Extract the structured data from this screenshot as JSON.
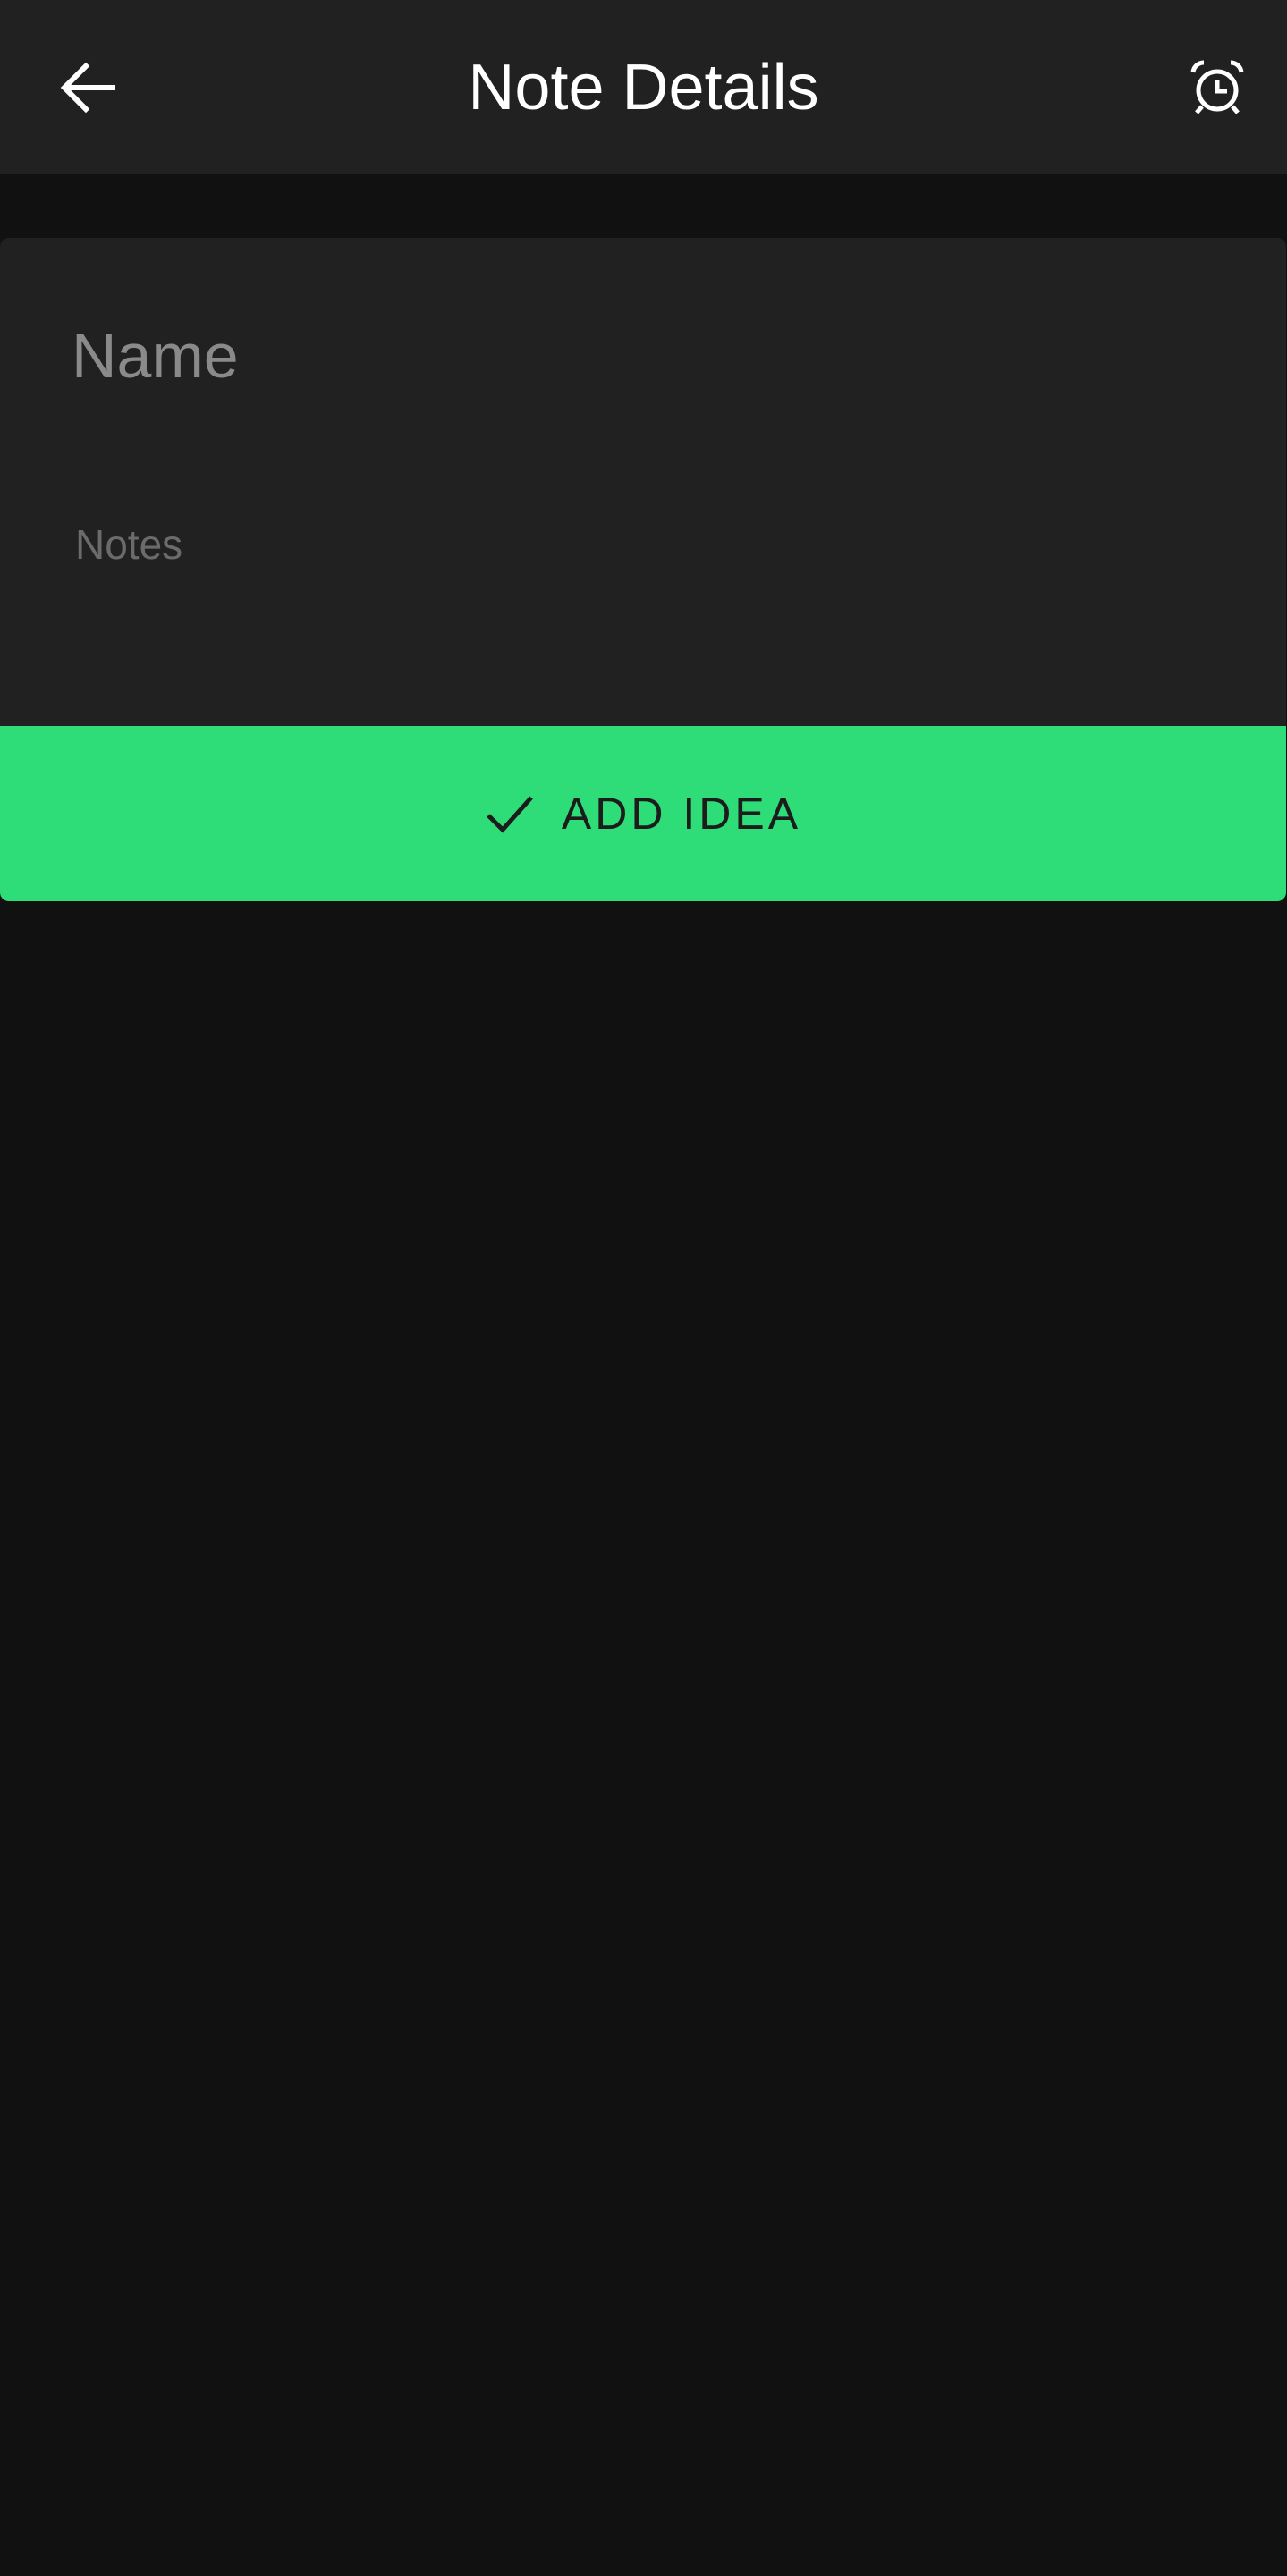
{
  "app_bar": {
    "title": "Note Details",
    "back_icon": "arrow-back-icon",
    "alarm_icon": "alarm-clock-icon",
    "background": "#212121"
  },
  "form": {
    "name": {
      "value": "",
      "placeholder": "Name"
    },
    "notes": {
      "value": "",
      "placeholder": "Notes"
    }
  },
  "add_button": {
    "label": "ADD IDEA",
    "icon": "check-icon",
    "color": "#2edd77"
  },
  "colors": {
    "page_background": "#121112",
    "card_background": "#212121",
    "accent": "#2edd77"
  }
}
